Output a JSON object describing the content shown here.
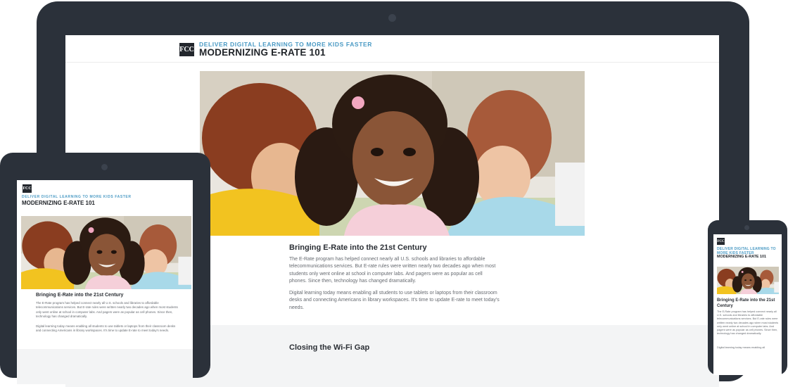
{
  "site": {
    "logo_text": "FCC",
    "kicker": "DELIVER DIGITAL LEARNING TO MORE KIDS FASTER",
    "title": "MODERNIZING E-RATE 101"
  },
  "hero": {
    "alt": "Smiling student in classroom with classmates using laptops"
  },
  "article": {
    "heading": "Bringing E-Rate into the 21st Century",
    "para1": "The E-Rate program has helped connect nearly all U.S. schools and libraries to affordable telecommunications services. But E-rate rules were written nearly two decades ago when most students only went online at school in computer labs. And pagers were as popular as cell phones. Since then, technology has changed dramatically.",
    "para2": "Digital learning today means enabling all students to use tablets or laptops from their classroom desks and connecting Americans in library workspaces. It's time to update E-rate to meet today's needs."
  },
  "section2": {
    "heading": "Closing the Wi-Fi Gap"
  },
  "phone_para2": "Digital learning today means enabling all",
  "colors": {
    "device": "#2b313a",
    "kicker": "#4a9ac4",
    "title": "#1f2328",
    "body_text": "#666a70",
    "section_bg": "#f3f4f5"
  }
}
